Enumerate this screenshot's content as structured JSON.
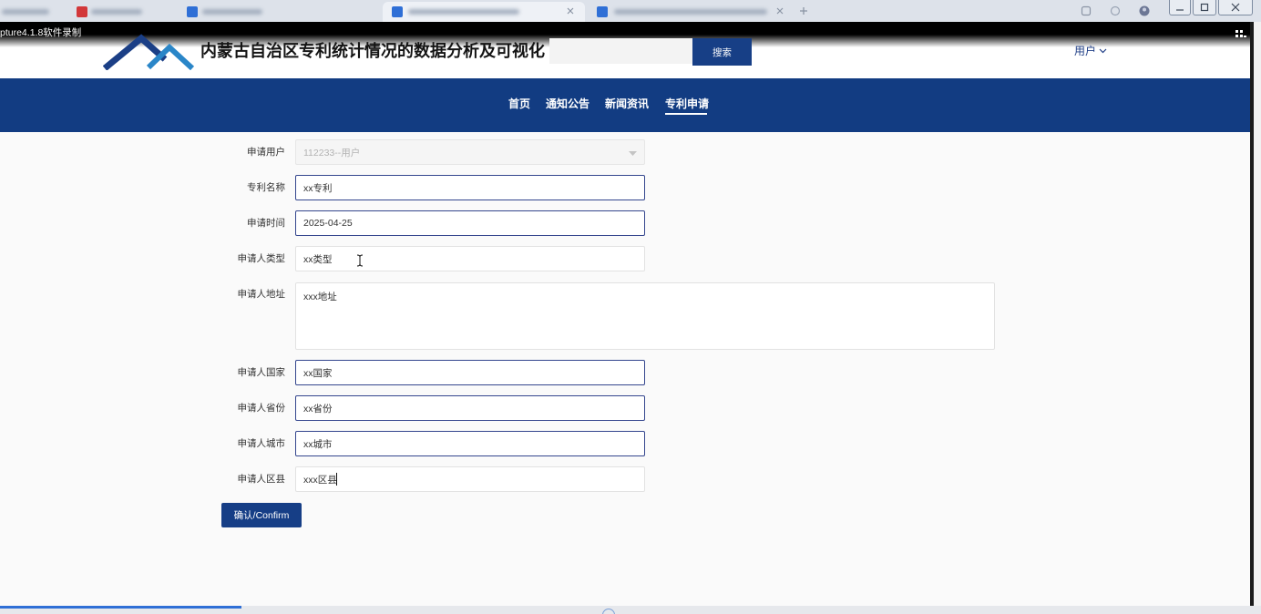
{
  "recorder": {
    "label": "pture4.1.8软件录制"
  },
  "header": {
    "title": "内蒙古自治区专利统计情况的数据分析及可视化",
    "search_button": "搜索",
    "user_menu": "用户"
  },
  "nav": {
    "items": [
      {
        "label": "首页",
        "active": false
      },
      {
        "label": "通知公告",
        "active": false
      },
      {
        "label": "新闻资讯",
        "active": false
      },
      {
        "label": "专利申请",
        "active": true
      }
    ]
  },
  "form": {
    "fields": [
      {
        "label": "申请用户",
        "value": "112233--用户",
        "disabled": true
      },
      {
        "label": "专利名称",
        "value": "xx专利"
      },
      {
        "label": "申请时间",
        "value": "2025-04-25"
      },
      {
        "label": "申请人类型",
        "value": "xx类型"
      },
      {
        "label": "申请人地址",
        "value": "xxx地址"
      },
      {
        "label": "申请人国家",
        "value": "xx国家"
      },
      {
        "label": "申请人省份",
        "value": "xx省份"
      },
      {
        "label": "申请人城市",
        "value": "xx城市"
      },
      {
        "label": "申请人区县",
        "value": "xxx区县"
      }
    ],
    "submit_label": "确认/Confirm"
  },
  "icons": {
    "logo": "mountain-logo-icon",
    "user_menu": "chevron-down-icon",
    "select": "caret-down-icon",
    "pointer": "i-beam-cursor-icon"
  },
  "colors": {
    "nav_background": "#123c82",
    "primary_button": "#163e86",
    "focused_border": "#34468e",
    "user_menu_text": "#1f3e86"
  }
}
